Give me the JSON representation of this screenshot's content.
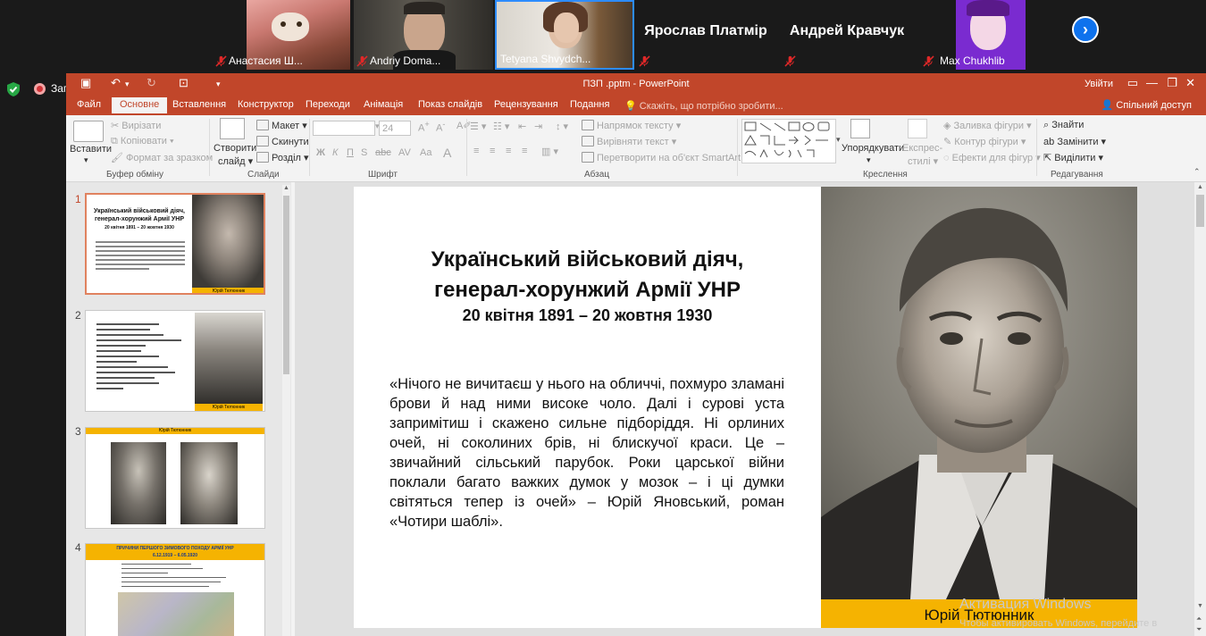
{
  "zoom": {
    "participants": [
      {
        "name": "Анастасия Ш...",
        "has_video": true
      },
      {
        "name": "Andriy Doma...",
        "has_video": true
      },
      {
        "name": "Tetyana Shvydch...",
        "has_video": true
      },
      {
        "name": "Ярослав Платмір",
        "has_video": false
      },
      {
        "name": "Андрей Кравчук",
        "has_video": false
      },
      {
        "name": "Max Chukhlib",
        "has_video": true
      }
    ],
    "recording_label": "Запись",
    "colors": {
      "mic_muted": "#e02828",
      "next_button": "#0e72ed",
      "record": "#d13438"
    }
  },
  "powerpoint": {
    "window_title": "ПЗП .pptm - PowerPoint",
    "sign_in": "Увійти",
    "share": "Спільний доступ",
    "tell_me": "Скажіть, що потрібно зробити...",
    "tabs": [
      "Файл",
      "Основне",
      "Вставлення",
      "Конструктор",
      "Переходи",
      "Анімація",
      "Показ слайдів",
      "Рецензування",
      "Подання"
    ],
    "active_tab": "Основне",
    "ribbon": {
      "paste": "Вставити",
      "cut": "Вирізати",
      "copy": "Копіювати",
      "format_painter": "Формат за зразком",
      "clipboard_group": "Буфер обміну",
      "new_slide": "Створити",
      "new_slide_2": "слайд",
      "layout": "Макет",
      "reset": "Скинути",
      "section": "Розділ",
      "slides_group": "Слайди",
      "font_size": "24",
      "bold": "Ж",
      "italic": "К",
      "underline": "П",
      "strike": "S",
      "font_group": "Шрифт",
      "text_direction": "Напрямок тексту",
      "align_text": "Вирівняти текст",
      "convert_smartart": "Перетворити на об'єкт SmartArt",
      "paragraph_group": "Абзац",
      "arrange": "Упорядкувати",
      "quick_styles": "Експрес-",
      "quick_styles_2": "стилі",
      "shape_fill": "Заливка фігури",
      "shape_outline": "Контур фігури",
      "shape_effects": "Ефекти для фігур",
      "drawing_group": "Креслення",
      "find": "Знайти",
      "replace": "Замінити",
      "select": "Виділити",
      "editing_group": "Редагування"
    },
    "slide_numbers": [
      "1",
      "2",
      "3",
      "4"
    ],
    "colors": {
      "accent": "#c1462a",
      "caption_bar": "#f5b301"
    }
  },
  "slide": {
    "title_line1": "Український військовий діяч,",
    "title_line2": "генерал-хорунжий Армії УНР",
    "dates": "20 квітня 1891 – 20 жовтня 1930",
    "quote": "«Нічого не вичитаєш у нього на обличчі, похмуро зламані брови й над ними високе чоло. Далі і сурові уста запримітиш і скажено сильне підборіддя. Ні орлиних очей, ні соколиних брів, ні блискучої краси. Це – звичайний сільський парубок. Роки царської війни поклали багато важких думок у мозок – і ці думки світяться тепер із очей» – Юрій Яновський, роман «Чотири шаблі».",
    "caption": "Юрій Тютюнник"
  },
  "thumbnails": {
    "t1_title": "Український військовий діяч, генерал-хорунжий Армії УНР",
    "t1_dates": "20 квітня 1891 – 20 жовтня 1930",
    "t1_caption": "Юрій Тютюнник",
    "t2_caption": "Юрій Тютюнник",
    "t3_caption": "Юрій Тютюнник",
    "t4_title": "ПРИЧИНИ ПЕРШОГО ЗИМОВОГО ПОХОДУ АРМІЇ УНР",
    "t4_dates": "6.12.1919 – 6.05.1920"
  },
  "watermark": {
    "line1": "Активация Windows",
    "line2": "Чтобы активировать Windows, перейдите в"
  }
}
